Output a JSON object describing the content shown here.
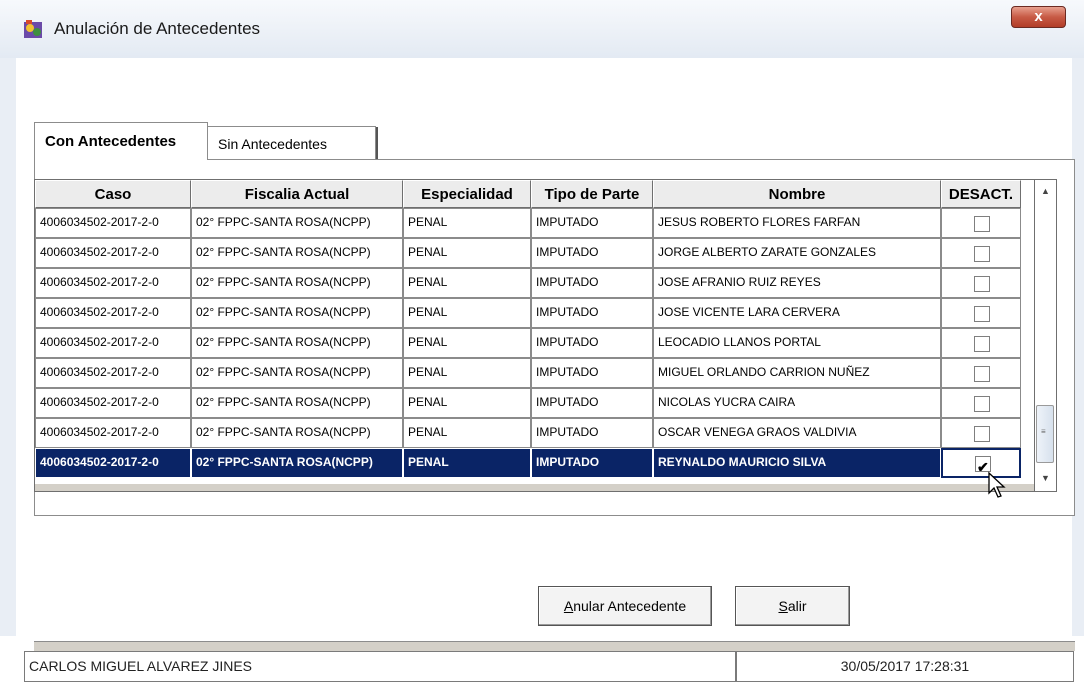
{
  "window": {
    "title": "Anulación de Antecedentes",
    "close_label": "x"
  },
  "tabs": [
    {
      "label": "Con Antecedentes",
      "active": true
    },
    {
      "label": "Sin Antecedentes",
      "active": false
    }
  ],
  "grid": {
    "columns": [
      "Caso",
      "Fiscalia Actual",
      "Especialidad",
      "Tipo de Parte",
      "Nombre",
      "DESACT."
    ],
    "rows": [
      {
        "caso": "4006034502-2017-2-0",
        "fiscalia": "02° FPPC-SANTA ROSA(NCPP)",
        "especialidad": "PENAL",
        "tipo": "IMPUTADO",
        "nombre": "JESUS ROBERTO FLORES FARFAN",
        "desact": false,
        "selected": false
      },
      {
        "caso": "4006034502-2017-2-0",
        "fiscalia": "02° FPPC-SANTA ROSA(NCPP)",
        "especialidad": "PENAL",
        "tipo": "IMPUTADO",
        "nombre": "JORGE ALBERTO ZARATE GONZALES",
        "desact": false,
        "selected": false
      },
      {
        "caso": "4006034502-2017-2-0",
        "fiscalia": "02° FPPC-SANTA ROSA(NCPP)",
        "especialidad": "PENAL",
        "tipo": "IMPUTADO",
        "nombre": "JOSE  AFRANIO RUIZ REYES",
        "desact": false,
        "selected": false
      },
      {
        "caso": "4006034502-2017-2-0",
        "fiscalia": "02° FPPC-SANTA ROSA(NCPP)",
        "especialidad": "PENAL",
        "tipo": "IMPUTADO",
        "nombre": "JOSE VICENTE LARA CERVERA",
        "desact": false,
        "selected": false
      },
      {
        "caso": "4006034502-2017-2-0",
        "fiscalia": "02° FPPC-SANTA ROSA(NCPP)",
        "especialidad": "PENAL",
        "tipo": "IMPUTADO",
        "nombre": "LEOCADIO LLANOS PORTAL",
        "desact": false,
        "selected": false
      },
      {
        "caso": "4006034502-2017-2-0",
        "fiscalia": "02° FPPC-SANTA ROSA(NCPP)",
        "especialidad": "PENAL",
        "tipo": "IMPUTADO",
        "nombre": "MIGUEL ORLANDO CARRION NUÑEZ",
        "desact": false,
        "selected": false
      },
      {
        "caso": "4006034502-2017-2-0",
        "fiscalia": "02° FPPC-SANTA ROSA(NCPP)",
        "especialidad": "PENAL",
        "tipo": "IMPUTADO",
        "nombre": "NICOLAS YUCRA CAIRA",
        "desact": false,
        "selected": false
      },
      {
        "caso": "4006034502-2017-2-0",
        "fiscalia": "02° FPPC-SANTA ROSA(NCPP)",
        "especialidad": "PENAL",
        "tipo": "IMPUTADO",
        "nombre": "OSCAR VENEGA GRAOS VALDIVIA",
        "desact": false,
        "selected": false
      },
      {
        "caso": "4006034502-2017-2-0",
        "fiscalia": "02° FPPC-SANTA ROSA(NCPP)",
        "especialidad": "PENAL",
        "tipo": "IMPUTADO",
        "nombre": "REYNALDO MAURICIO SILVA",
        "desact": true,
        "selected": true
      }
    ]
  },
  "buttons": {
    "anular_mnemonic": "A",
    "anular_rest": "nular Antecedente",
    "salir_mnemonic": "S",
    "salir_rest": "alir"
  },
  "status": {
    "user": "CARLOS MIGUEL ALVAREZ JINES",
    "datetime": "30/05/2017 17:28:31"
  },
  "colors": {
    "selection": "#0a2466",
    "close_button": "#c75a45"
  }
}
